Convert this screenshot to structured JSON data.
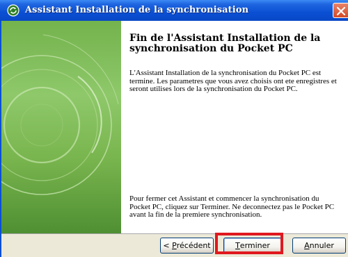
{
  "window": {
    "title": "Assistant Installation de la synchronisation",
    "icon": "sync-icon",
    "close_icon": "close-icon",
    "title_color": "#0a4fd4"
  },
  "content": {
    "heading": "Fin de l'Assistant Installation de la synchronisation du Pocket PC",
    "paragraph1": "L'Assistant Installation de la synchronisation du Pocket PC est termine. Les parametres que vous avez choisis ont ete enregistres et seront utilises lors de la synchronisation du Pocket PC.",
    "paragraph2": "Pour fermer cet Assistant et commencer la synchronisation du Pocket PC, cliquez sur Terminer. Ne deconnectez pas le Pocket PC avant la fin de la premiere synchronisation."
  },
  "buttons": {
    "back": {
      "prefix": "< ",
      "mnemonic": "P",
      "rest": "récédent"
    },
    "finish": {
      "mnemonic": "T",
      "rest": "erminer"
    },
    "cancel": {
      "mnemonic": "A",
      "rest": "nnuler"
    }
  },
  "colors": {
    "art_panel": "#8ec86a",
    "highlight": "#e0191f"
  }
}
